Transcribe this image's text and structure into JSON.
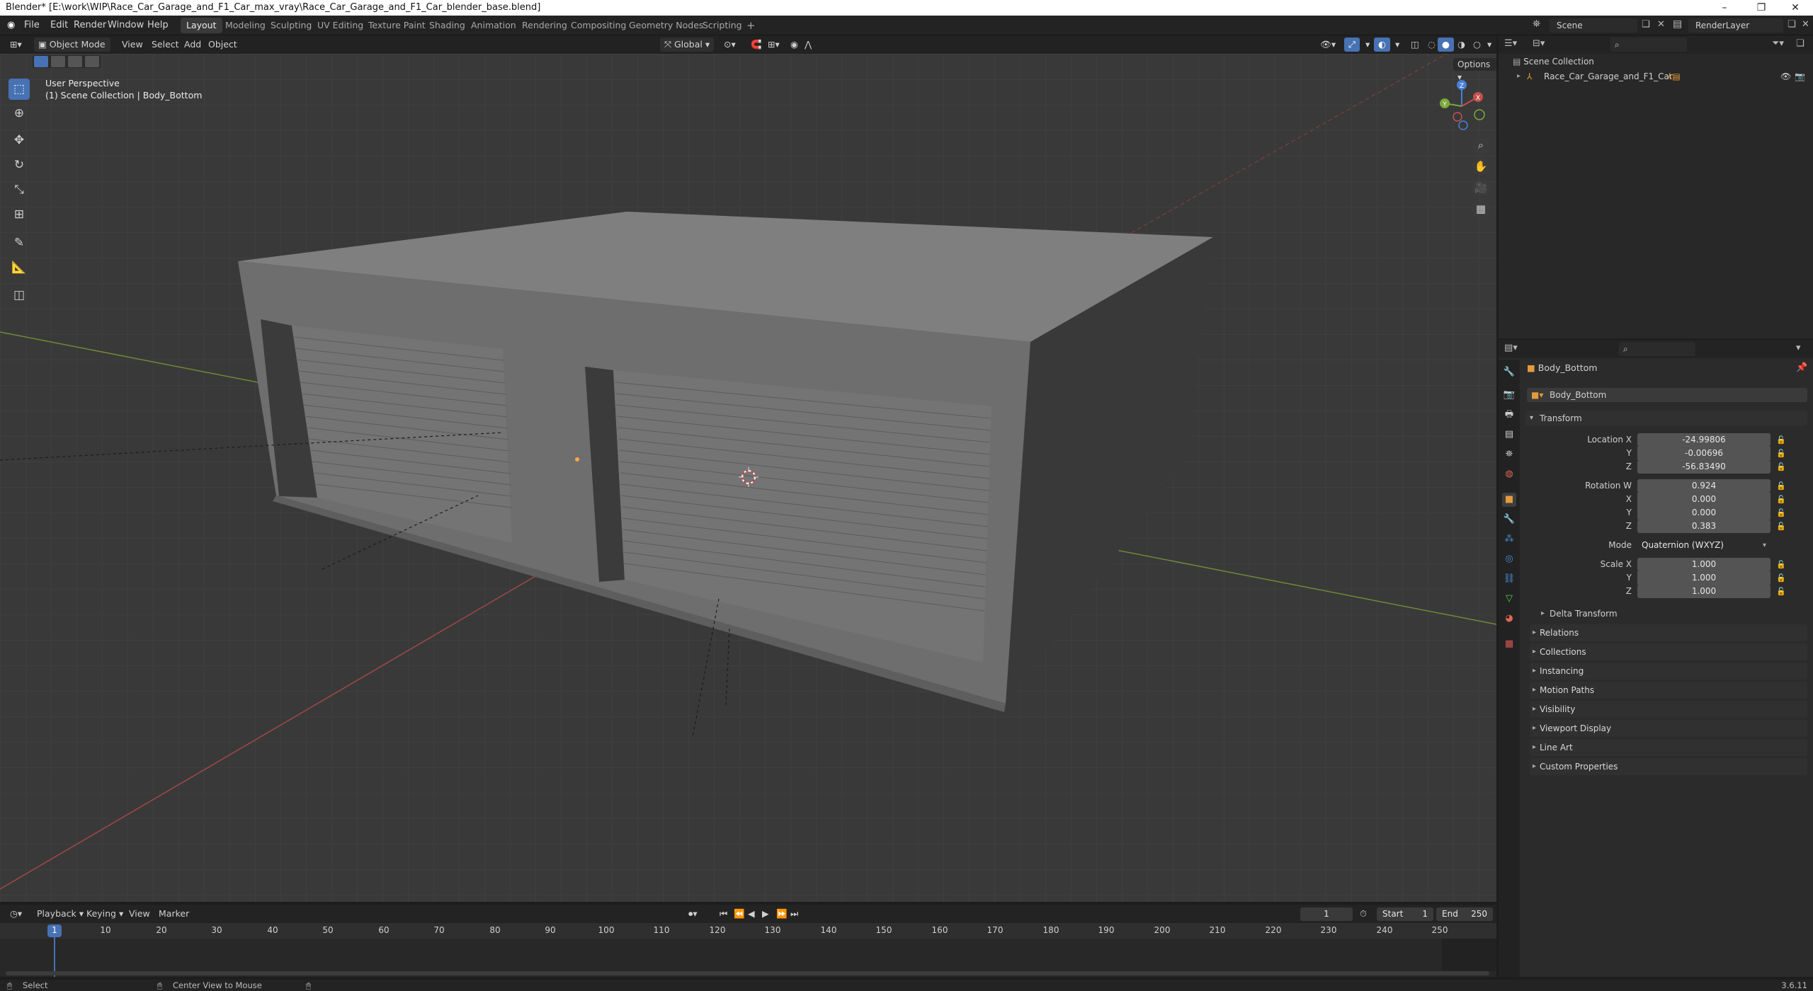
{
  "window": {
    "title": "Blender* [E:\\work\\WIP\\Race_Car_Garage_and_F1_Car_max_vray\\Race_Car_Garage_and_F1_Car_blender_base.blend]",
    "version": "3.6.11"
  },
  "menu": {
    "file": "File",
    "edit": "Edit",
    "render": "Render",
    "window": "Window",
    "help": "Help"
  },
  "workspaces": [
    "Layout",
    "Modeling",
    "Sculpting",
    "UV Editing",
    "Texture Paint",
    "Shading",
    "Animation",
    "Rendering",
    "Compositing",
    "Geometry Nodes",
    "Scripting"
  ],
  "scene": {
    "name": "Scene",
    "view_layer": "RenderLayer"
  },
  "viewport_header": {
    "mode": "Object Mode",
    "view": "View",
    "select": "Select",
    "add": "Add",
    "object": "Object",
    "orientation": "Global",
    "options": "Options"
  },
  "viewport": {
    "perspective": "User Perspective",
    "collection_info": "(1) Scene Collection | Body_Bottom",
    "axes": {
      "x": "X",
      "y": "Y",
      "z": "Z"
    }
  },
  "outliner": {
    "root": "Scene Collection",
    "items": [
      {
        "label": "Race_Car_Garage_and_F1_Car"
      }
    ]
  },
  "properties": {
    "object_name": "Body_Bottom",
    "data_name": "Body_Bottom",
    "transform": {
      "header": "Transform",
      "location_label": "Location X",
      "location": [
        "-24.99806",
        "-0.00696",
        "-56.83490"
      ],
      "rotation_label": "Rotation W",
      "rotation": [
        "0.924",
        "0.000",
        "0.000",
        "0.383"
      ],
      "mode_label": "Mode",
      "mode": "Quaternion (WXYZ)",
      "scale_label": "Scale X",
      "scale": [
        "1.000",
        "1.000",
        "1.000"
      ],
      "axis_y": "Y",
      "axis_z": "Z",
      "axis_x": "X"
    },
    "subpanels": {
      "delta": "Delta Transform",
      "list": [
        "Relations",
        "Collections",
        "Instancing",
        "Motion Paths",
        "Visibility",
        "Viewport Display",
        "Line Art",
        "Custom Properties"
      ]
    }
  },
  "timeline": {
    "playback": "Playback",
    "keying": "Keying",
    "view": "View",
    "marker": "Marker",
    "current_frame": "1",
    "start_label": "Start",
    "start": "1",
    "end_label": "End",
    "end": "250",
    "ticks": [
      "1",
      "10",
      "20",
      "30",
      "40",
      "50",
      "60",
      "70",
      "80",
      "90",
      "100",
      "110",
      "120",
      "130",
      "140",
      "150",
      "160",
      "170",
      "180",
      "190",
      "200",
      "210",
      "220",
      "230",
      "240",
      "250"
    ]
  },
  "status": {
    "select": "Select",
    "center_view": "Center View to Mouse"
  },
  "colors": {
    "accent": "#4772b3",
    "x_axis": "#c64f4f",
    "y_axis": "#7ca83c",
    "z_axis": "#4a7fd6",
    "origin": "#ffa64d"
  }
}
